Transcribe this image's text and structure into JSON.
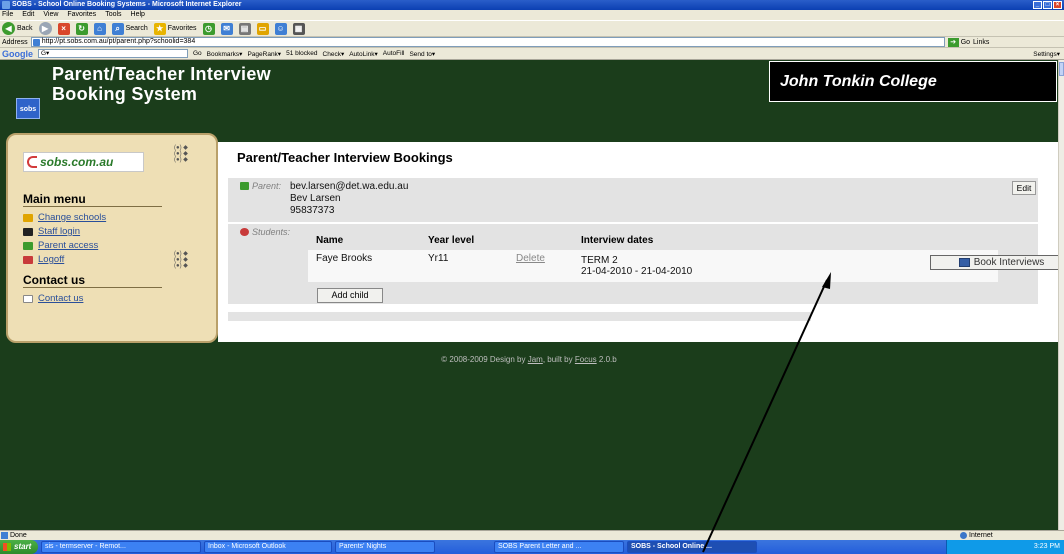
{
  "window": {
    "title": "SOBS - School Online Booking Systems - Microsoft Internet Explorer"
  },
  "menubar": [
    "File",
    "Edit",
    "View",
    "Favorites",
    "Tools",
    "Help"
  ],
  "toolbar": {
    "back": "Back",
    "search": "Search",
    "favorites": "Favorites"
  },
  "address": {
    "label": "Address",
    "url": "http://pt.sobs.com.au/pt/parent.php?schoolid=384",
    "go": "Go",
    "links": "Links"
  },
  "googlebar": {
    "logo": "Google",
    "input": "G▾",
    "go": "Go",
    "bookmarks": "Bookmarks▾",
    "pagerank": "PageRank▾",
    "blocked": "51 blocked",
    "check": "Check▾",
    "autolink": "AutoLink▾",
    "autofill": "AutoFill",
    "sendto": "Send to▾",
    "settings": "Settings▾"
  },
  "site": {
    "logo_text": "sobs",
    "title_line1": "Parent/Teacher Interview",
    "title_line2": "Booking System",
    "school_name": "John Tonkin College"
  },
  "sidebar": {
    "brand": "sobs.com.au",
    "main_menu_heading": "Main menu",
    "items": [
      {
        "label": "Change schools"
      },
      {
        "label": "Staff login"
      },
      {
        "label": "Parent access"
      },
      {
        "label": "Logoff"
      }
    ],
    "contact_heading": "Contact us",
    "contact_link": "Contact us"
  },
  "main": {
    "heading": "Parent/Teacher Interview Bookings",
    "parent_label": "Parent:",
    "parent_email": "bev.larsen@det.wa.edu.au",
    "parent_name": "Bev Larsen",
    "parent_phone": "95837373",
    "edit_label": "Edit",
    "students_label": "Students:",
    "columns": [
      "Name",
      "Year level",
      "Interview dates"
    ],
    "students": [
      {
        "name": "Faye Brooks",
        "year": "Yr11",
        "delete": "Delete",
        "term": "TERM 2",
        "dates": "21-04-2010 - 21-04-2010",
        "book_label": "Book Interviews"
      }
    ],
    "add_child_label": "Add child"
  },
  "footer": {
    "prefix": "© 2008-2009 Design by",
    "design_link": "Jam",
    "middle": ", built by",
    "built_link": "Focus",
    "version": "2.0.b"
  },
  "statusbar": {
    "text": "Done",
    "zone": "Internet"
  },
  "taskbar": {
    "start": "start",
    "items": [
      "sis - termserver - Remot...",
      "Inbox - Microsoft Outlook",
      "Parents' Nights",
      "SOBS Parent Letter and ...",
      "SOBS - School Online ..."
    ],
    "clock": "3:23 PM"
  },
  "colors": {
    "page_bg": "#1b3d1b",
    "sidebar_bg": "#eedfb5",
    "panel_bg": "#e3e3e3",
    "link": "#2a4f9a",
    "arrow": "#000000"
  }
}
